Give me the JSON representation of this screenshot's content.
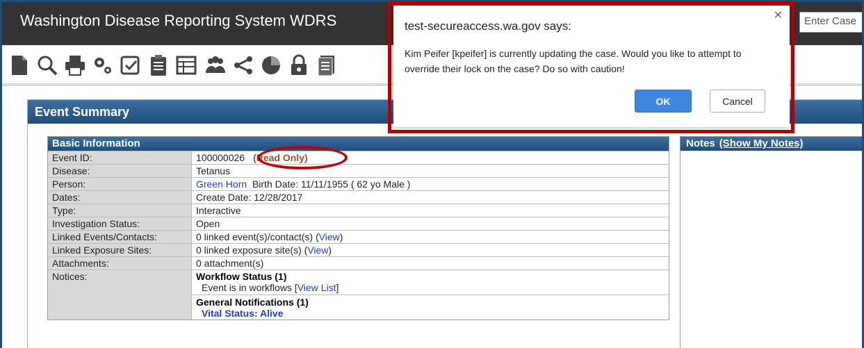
{
  "app": {
    "title": "Washington Disease Reporting System WDRS",
    "case_search_placeholder": "Enter Case"
  },
  "toolbar": {
    "icons": [
      "new-document-icon",
      "search-icon",
      "print-icon",
      "settings-icon",
      "checklist-icon",
      "clipboard-icon",
      "table-icon",
      "people-icon",
      "share-icon",
      "pie-chart-icon",
      "lock-icon",
      "notes-stack-icon"
    ]
  },
  "event_summary": {
    "title": "Event Summary"
  },
  "basic_info": {
    "header": "Basic Information",
    "event_id_label": "Event ID:",
    "event_id_value": "100000026",
    "read_only": "(Read Only)",
    "disease_label": "Disease:",
    "disease_value": "Tetanus",
    "person_label": "Person:",
    "person_name": "Green Horn",
    "person_details": "Birth Date: 11/11/1955 ( 62 yo Male )",
    "dates_label": "Dates:",
    "dates_value": "Create Date: 12/28/2017",
    "type_label": "Type:",
    "type_value": "Interactive",
    "inv_status_label": "Investigation Status:",
    "inv_status_value": "Open",
    "linked_events_label": "Linked Events/Contacts:",
    "linked_events_value": "0 linked event(s)/contact(s) (",
    "linked_events_link": "View",
    "linked_events_close": ")",
    "linked_sites_label": "Linked Exposure Sites:",
    "linked_sites_value": "0 linked exposure site(s) (",
    "linked_sites_link": "View",
    "linked_sites_close": ")",
    "attachments_label": "Attachments:",
    "attachments_value": "0 attachment(s)",
    "notices_label": "Notices:",
    "workflow_title": "Workflow Status (1)",
    "workflow_text": "Event is in workflows [",
    "workflow_link": "View List",
    "workflow_close": "]",
    "general_title": "General Notifications (1)",
    "vital_status": "Vital Status: Alive"
  },
  "notes": {
    "header": "Notes",
    "link": "(Show My Notes)"
  },
  "dialog": {
    "title": "test-secureaccess.wa.gov says:",
    "message": "Kim Peifer [kpeifer] is currently updating the case.  Would you like to attempt to override their lock on the case? Do so with caution!",
    "ok_label": "OK",
    "cancel_label": "Cancel",
    "close_glyph": "✕"
  },
  "colors": {
    "header_blue": "#1f4e79",
    "highlight_red": "#c00000",
    "link_blue": "#1a3fcc",
    "read_only": "#a0522d",
    "ok_button": "#3d87e0"
  }
}
